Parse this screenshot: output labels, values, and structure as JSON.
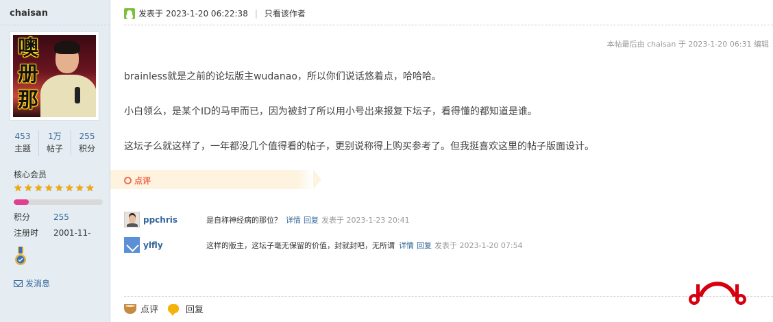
{
  "sidebar": {
    "username": "chaisan",
    "avatar_text": [
      "噢",
      "册",
      "那"
    ],
    "stats": [
      {
        "num": "453",
        "label": "主题"
      },
      {
        "num": "1万",
        "label": "帖子"
      },
      {
        "num": "255",
        "label": "积分"
      }
    ],
    "group": "核心会员",
    "stars": 8,
    "progress": 0.17,
    "info": [
      {
        "key": "积分",
        "value": "255"
      },
      {
        "key": "注册时",
        "value": "2001-11-"
      }
    ],
    "pm_label": "发消息"
  },
  "post": {
    "posted_prefix": "发表于",
    "posted_time": "2023-1-20 06:22:38",
    "only_author": "只看该作者",
    "edited": "本帖最后由 chaisan 于 2023-1-20 06:31 编辑",
    "paragraphs": [
      "brainless就是之前的论坛版主wudanao，所以你们说话悠着点，哈哈哈。",
      "小白领么，是某个ID的马甲而已，因为被封了所以用小号出来报复下坛子，看得懂的都知道是谁。",
      "这坛子么就这样了，一年都没几个值得看的帖子，更别说称得上购买参考了。但我挺喜欢这里的帖子版面设计。"
    ]
  },
  "comments": {
    "tag_label": "点评",
    "items": [
      {
        "user": "ppchris",
        "text": "是自称神经病的那位？",
        "detail": "详情",
        "reply": "回复",
        "time": "发表于 2023-1-23 20:41"
      },
      {
        "user": "ylfly",
        "text": "这样的版主，这坛子毫无保留的价值，封就封吧，无所谓",
        "detail": "详情",
        "reply": "回复",
        "time": "发表于 2023-1-20 07:54"
      }
    ]
  },
  "actions": {
    "comment_label": "点评",
    "reply_label": "回复"
  },
  "colors": {
    "accent": "#336699",
    "logo": "#d7000f",
    "comment_tag": "#f26c4f"
  }
}
